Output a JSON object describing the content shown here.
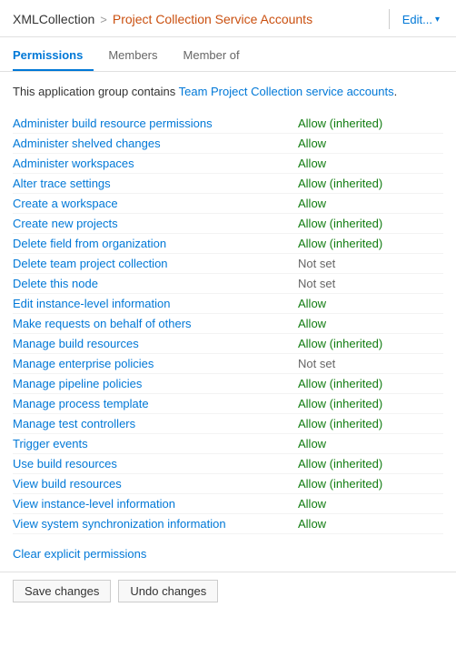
{
  "breadcrumb": {
    "part1": "XMLCollection",
    "sep": ">",
    "part2": "Project Collection Service Accounts"
  },
  "edit_button": "Edit...",
  "tabs": [
    {
      "id": "permissions",
      "label": "Permissions",
      "active": true
    },
    {
      "id": "members",
      "label": "Members",
      "active": false
    },
    {
      "id": "member-of",
      "label": "Member of",
      "active": false
    }
  ],
  "description": {
    "prefix": "This application group contains ",
    "highlight": "Team Project Collection service accounts",
    "suffix": "."
  },
  "permissions": [
    {
      "name": "Administer build resource permissions",
      "value": "Allow (inherited)",
      "status": "allow-inherited"
    },
    {
      "name": "Administer shelved changes",
      "value": "Allow",
      "status": "allow"
    },
    {
      "name": "Administer workspaces",
      "value": "Allow",
      "status": "allow"
    },
    {
      "name": "Alter trace settings",
      "value": "Allow (inherited)",
      "status": "allow-inherited"
    },
    {
      "name": "Create a workspace",
      "value": "Allow",
      "status": "allow"
    },
    {
      "name": "Create new projects",
      "value": "Allow (inherited)",
      "status": "allow-inherited"
    },
    {
      "name": "Delete field from organization",
      "value": "Allow (inherited)",
      "status": "allow-inherited"
    },
    {
      "name": "Delete team project collection",
      "value": "Not set",
      "status": "not-set"
    },
    {
      "name": "Delete this node",
      "value": "Not set",
      "status": "not-set"
    },
    {
      "name": "Edit instance-level information",
      "value": "Allow",
      "status": "allow"
    },
    {
      "name": "Make requests on behalf of others",
      "value": "Allow",
      "status": "allow"
    },
    {
      "name": "Manage build resources",
      "value": "Allow (inherited)",
      "status": "allow-inherited"
    },
    {
      "name": "Manage enterprise policies",
      "value": "Not set",
      "status": "not-set"
    },
    {
      "name": "Manage pipeline policies",
      "value": "Allow (inherited)",
      "status": "allow-inherited"
    },
    {
      "name": "Manage process template",
      "value": "Allow (inherited)",
      "status": "allow-inherited"
    },
    {
      "name": "Manage test controllers",
      "value": "Allow (inherited)",
      "status": "allow-inherited"
    },
    {
      "name": "Trigger events",
      "value": "Allow",
      "status": "allow"
    },
    {
      "name": "Use build resources",
      "value": "Allow (inherited)",
      "status": "allow-inherited"
    },
    {
      "name": "View build resources",
      "value": "Allow (inherited)",
      "status": "allow-inherited"
    },
    {
      "name": "View instance-level information",
      "value": "Allow",
      "status": "allow"
    },
    {
      "name": "View system synchronization information",
      "value": "Allow",
      "status": "allow"
    }
  ],
  "clear_link": "Clear explicit permissions",
  "bottom_buttons": [
    "Save changes",
    "Undo changes"
  ]
}
